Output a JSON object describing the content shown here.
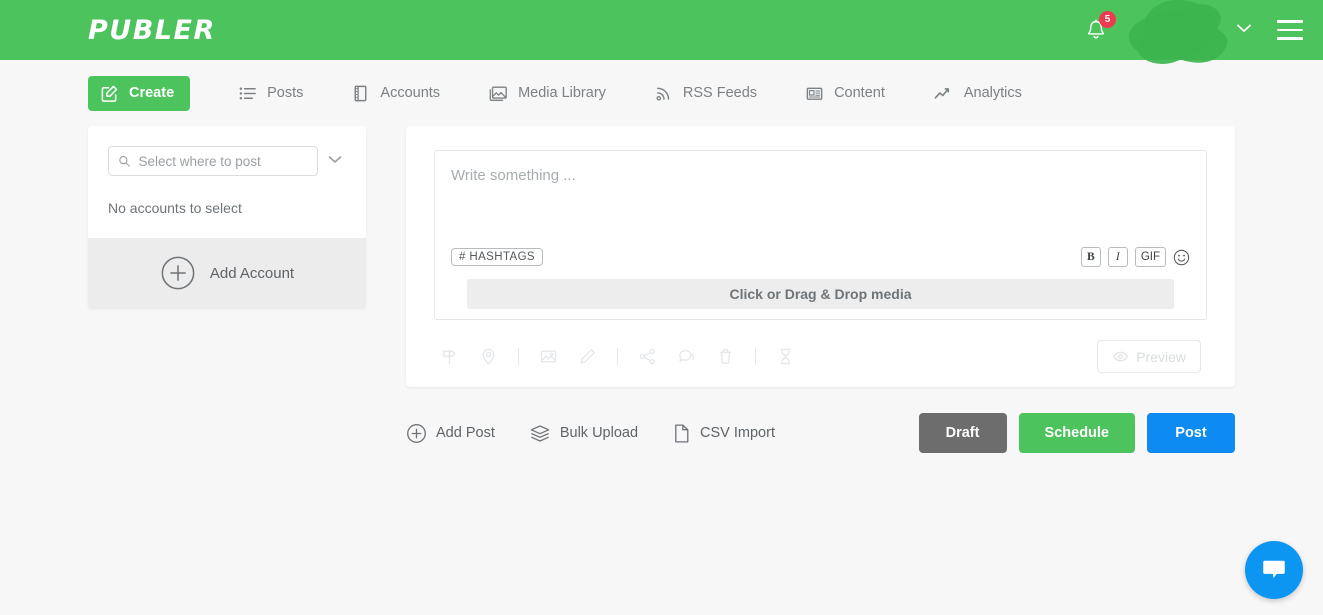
{
  "header": {
    "logo": "PUBLER",
    "notifications_count": "5",
    "bell_icon": "bell-icon",
    "avatar_icon": "avatar-redacted",
    "chevron_icon": "chevron-down-icon",
    "menu_icon": "hamburger-menu-icon",
    "bg_color": "#4cc35d"
  },
  "nav": {
    "items": [
      {
        "label": "Create",
        "icon": "edit-square-icon",
        "active": true
      },
      {
        "label": "Posts",
        "icon": "list-icon",
        "active": false
      },
      {
        "label": "Accounts",
        "icon": "book-icon",
        "active": false
      },
      {
        "label": "Media Library",
        "icon": "images-icon",
        "active": false
      },
      {
        "label": "RSS Feeds",
        "icon": "rss-icon",
        "active": false
      },
      {
        "label": "Content",
        "icon": "newspaper-icon",
        "active": false
      },
      {
        "label": "Analytics",
        "icon": "chart-line-icon",
        "active": false
      }
    ]
  },
  "accounts_panel": {
    "search_placeholder": "Select where to post",
    "search_value": "",
    "search_icon": "search-icon",
    "dropdown_icon": "chevron-down-icon",
    "empty_text": "No accounts to select",
    "add_account_label": "Add Account",
    "add_account_icon": "plus-circle-icon"
  },
  "composer": {
    "placeholder": "Write something ...",
    "text_value": "",
    "hashtags_label": "# HASHTAGS",
    "format_buttons": [
      {
        "label": "B",
        "name": "bold-button"
      },
      {
        "label": "I",
        "name": "italic-button"
      },
      {
        "label": "GIF",
        "name": "gif-button"
      }
    ],
    "emoji_icon": "smiley-icon",
    "dropzone_label": "Click or Drag & Drop media",
    "tools": [
      {
        "icon": "signpost-icon"
      },
      {
        "icon": "location-pin-icon"
      },
      {
        "icon": "divider"
      },
      {
        "icon": "image-icon"
      },
      {
        "icon": "pencil-icon"
      },
      {
        "icon": "divider"
      },
      {
        "icon": "share-icon"
      },
      {
        "icon": "comment-icon"
      },
      {
        "icon": "trash-icon"
      },
      {
        "icon": "divider"
      },
      {
        "icon": "hourglass-icon"
      }
    ],
    "preview_label": "Preview",
    "preview_icon": "eye-icon"
  },
  "footer": {
    "actions": [
      {
        "label": "Add Post",
        "icon": "plus-circle-icon"
      },
      {
        "label": "Bulk Upload",
        "icon": "layers-icon"
      },
      {
        "label": "CSV Import",
        "icon": "file-icon"
      }
    ],
    "buttons": [
      {
        "label": "Draft",
        "color": "#6d6d6d"
      },
      {
        "label": "Schedule",
        "color": "#4cc35d"
      },
      {
        "label": "Post",
        "color": "#0d8bf2"
      }
    ]
  },
  "chat_widget": {
    "icon": "chat-bubble-icon",
    "color": "#0d95f2"
  }
}
